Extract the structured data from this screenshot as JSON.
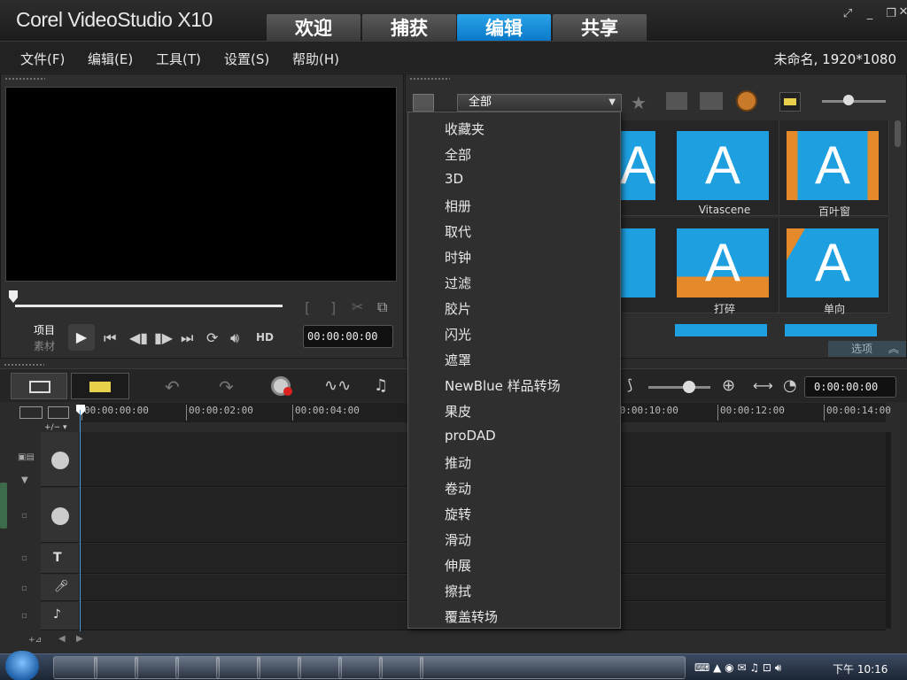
{
  "app": {
    "brand": "Corel VideoStudio X10",
    "tabs": [
      "欢迎",
      "捕获",
      "编辑",
      "共享"
    ],
    "active_tab": "编辑"
  },
  "menu": {
    "items": [
      "文件(F)",
      "编辑(E)",
      "工具(T)",
      "设置(S)",
      "帮助(H)"
    ],
    "project_info": "未命名, 1920*1080"
  },
  "player": {
    "mode_project": "项目",
    "mode_clip": "素材",
    "hd_label": "HD",
    "timecode": "00:00:00:00"
  },
  "library": {
    "category_value": "全部",
    "thumbs": [
      {
        "label": "",
        "letter": "A"
      },
      {
        "label": "Vitascene",
        "letter": "A"
      },
      {
        "label": "百叶窗",
        "letter": "A"
      },
      {
        "label": "",
        "letter": "A"
      },
      {
        "label": "打碎",
        "letter": "A"
      },
      {
        "label": "单向",
        "letter": "A"
      }
    ],
    "options_label": "选项"
  },
  "dropdown": {
    "items": [
      "收藏夹",
      "全部",
      "3D",
      "相册",
      "取代",
      "时钟",
      "过滤",
      "胶片",
      "闪光",
      "遮罩",
      "NewBlue 样品转场",
      "果皮",
      "proDAD",
      "推动",
      "卷动",
      "旋转",
      "滑动",
      "伸展",
      "擦拭",
      "覆盖转场"
    ]
  },
  "timeline": {
    "timecode": "0:00:00:00",
    "ruler_ticks": [
      "00:00:00:00",
      "00:00:02:00",
      "00:00:04:00",
      "00:00:10:00",
      "00:00:12:00",
      "00:00:14:00"
    ]
  },
  "taskbar": {
    "clock_label": "下午 10:16"
  }
}
